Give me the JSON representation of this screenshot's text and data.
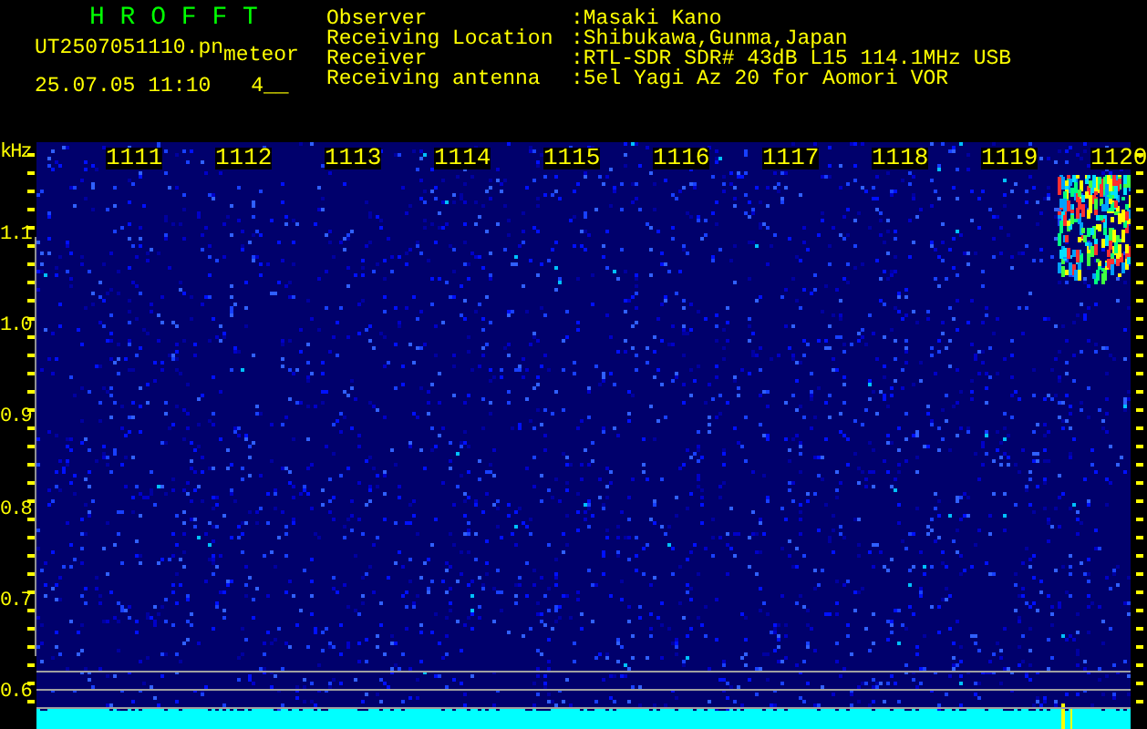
{
  "app": {
    "title": "H R O F F T",
    "file_name": "UT2507051110.pn",
    "mode": "meteor",
    "timestamp": "25.07.05 11:10",
    "counter": "4__"
  },
  "station": [
    {
      "label": "Observer",
      "value": ":Masaki Kano"
    },
    {
      "label": "Receiving Location",
      "value": ":Shibukawa,Gunma,Japan"
    },
    {
      "label": "Receiver",
      "value": ":RTL-SDR SDR# 43dB L15 114.1MHz USB"
    },
    {
      "label": "Receiving antenna",
      "value": ":5el Yagi Az 20 for Aomori VOR"
    }
  ],
  "spectrogram": {
    "unit": "kHz",
    "x_labels": [
      "1111",
      "1112",
      "1113",
      "1114",
      "1115",
      "1116",
      "1117",
      "1118",
      "1119",
      "1120"
    ],
    "y_labels": [
      "1.1",
      "1.0",
      "0.9",
      "0.8",
      "0.7",
      "0.6"
    ]
  }
}
